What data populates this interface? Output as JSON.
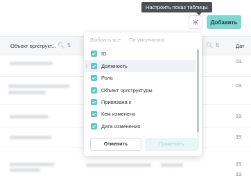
{
  "tooltip": {
    "text": "Настроить показ таблицы"
  },
  "toolbar": {
    "settings_icon": "gear-icon",
    "add_label": "Добавить"
  },
  "table": {
    "headers": {
      "org_unit": "Объект оргструкт...",
      "date_partial": "Дат"
    },
    "header_icons": {
      "search": "search-icon",
      "sort": "sort-icon"
    },
    "row_dates": [
      "03.",
      "03.",
      "19.",
      "19.",
      "19.",
      "19."
    ]
  },
  "column_settings": {
    "select_all": "Выбрать все",
    "defaults": "По умолчанию",
    "columns": [
      {
        "label": "ID",
        "checked": true
      },
      {
        "label": "Должность",
        "checked": true
      },
      {
        "label": "Роль",
        "checked": true
      },
      {
        "label": "Объект оргструктуры",
        "checked": true
      },
      {
        "label": "Привязана к",
        "checked": true
      },
      {
        "label": "Кем изменено",
        "checked": true
      },
      {
        "label": "Дата изменения",
        "checked": true
      }
    ],
    "cancel": "Отменить",
    "apply": "Применить"
  },
  "colors": {
    "accent": "#5dc7c3",
    "add_button": "#7fd6d3",
    "tooltip_bg": "#4a4f57"
  }
}
